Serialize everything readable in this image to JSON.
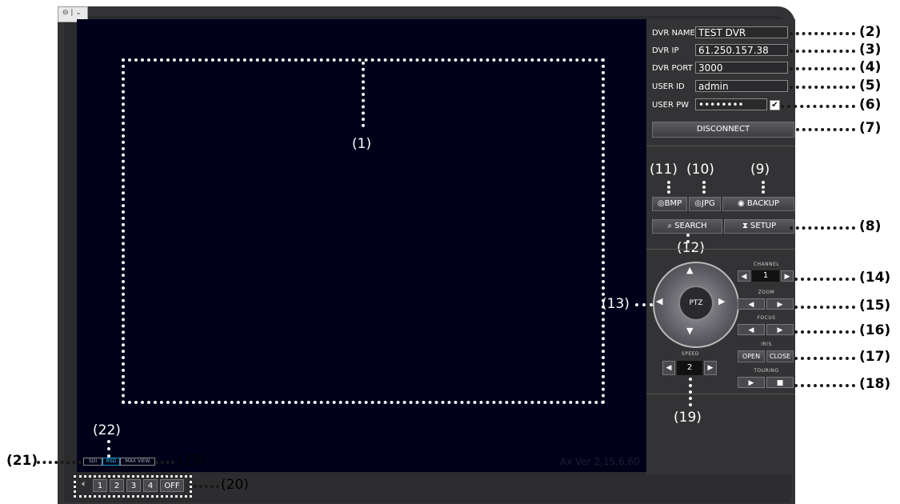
{
  "window": {
    "tab_glyph": "⊖ | ⌄"
  },
  "video": {
    "version": "Ax Ver 2,15,6,60"
  },
  "connection": {
    "dvr_name_label": "DVR NAME",
    "dvr_name_value": "TEST DVR",
    "dvr_ip_label": "DVR IP",
    "dvr_ip_value": "61.250.157.38",
    "dvr_port_label": "DVR PORT",
    "dvr_port_value": "3000",
    "user_id_label": "USER ID",
    "user_id_value": "admin",
    "user_pw_label": "USER PW",
    "user_pw_value": "••••••••",
    "save_pw_checked": true,
    "disconnect_label": "DISCONNECT"
  },
  "capture": {
    "bmp_label": "BMP",
    "jpg_label": "JPG",
    "backup_label": "BACKUP",
    "search_label": "SEARCH",
    "setup_label": "SETUP"
  },
  "ptz": {
    "label": "PTZ",
    "channel_label": "CHANNEL",
    "channel_value": "1",
    "zoom_label": "ZOOM",
    "focus_label": "FOCUS",
    "iris_label": "IRIS",
    "iris_open": "OPEN",
    "iris_close": "CLOSE",
    "touring_label": "TOURING",
    "speed_label": "SPEED",
    "speed_value": "2"
  },
  "display_modes": {
    "sdi": "SDI",
    "rsd": "RSD",
    "max_view": "MAX VIEW"
  },
  "audio": {
    "icon": "speaker-icon",
    "channels": [
      "1",
      "2",
      "3",
      "4"
    ],
    "off": "OFF"
  },
  "annotations": {
    "a1": "(1)",
    "a2": "(2)",
    "a3": "(3)",
    "a4": "(4)",
    "a5": "(5)",
    "a6": "(6)",
    "a7": "(7)",
    "a8": "(8)",
    "a9": "(9)",
    "a10": "(10)",
    "a11": "(11)",
    "a12": "(12)",
    "a13": "(13)",
    "a14": "(14)",
    "a15": "(15)",
    "a16": "(16)",
    "a17": "(17)",
    "a18": "(18)",
    "a19": "(19)",
    "a20": "(20)",
    "a21": "(21)",
    "a22": "(22)",
    "a23": "(23)"
  }
}
